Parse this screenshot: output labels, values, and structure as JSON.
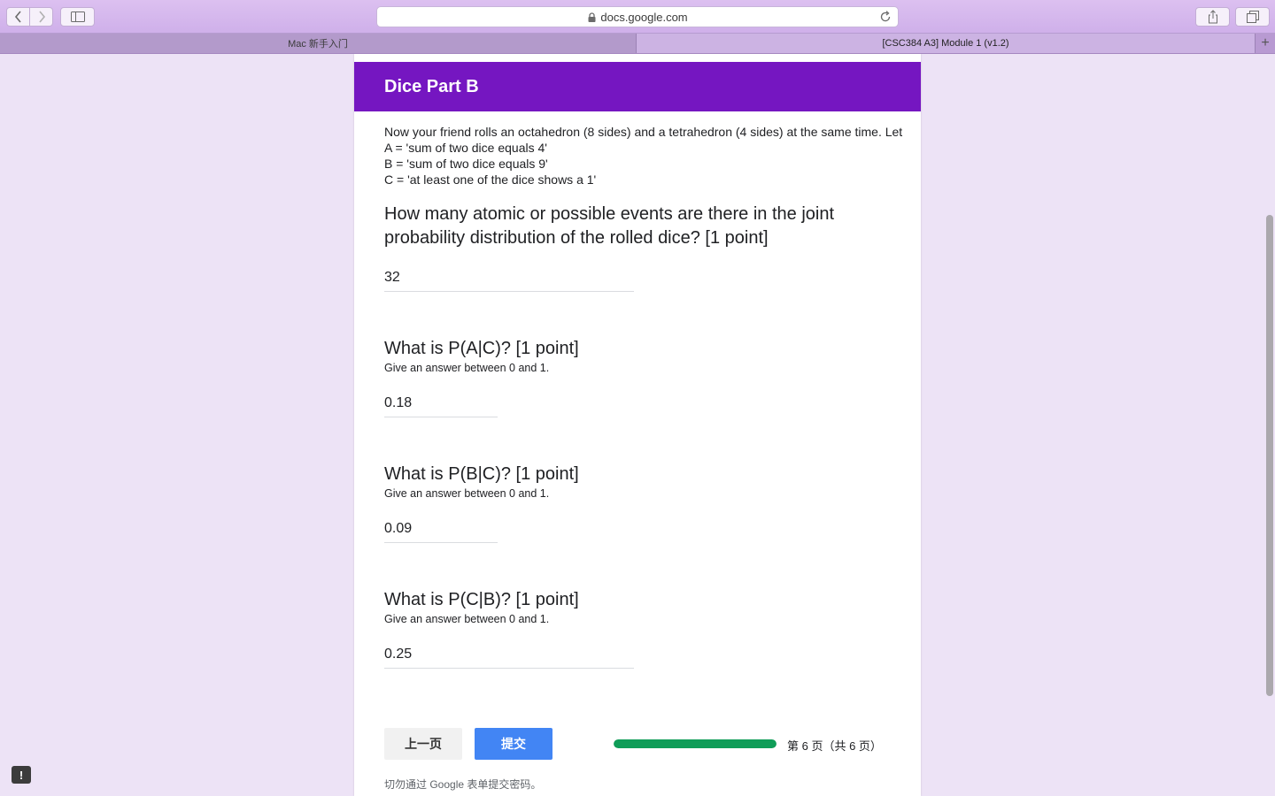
{
  "browser": {
    "url": "docs.google.com",
    "tabs": [
      {
        "label": "Mac 新手入门",
        "active": false
      },
      {
        "label": "[CSC384 A3] Module 1 (v1.2)",
        "active": true
      }
    ],
    "new_tab_symbol": "+"
  },
  "form": {
    "section_title": "Dice Part B",
    "intro_lines": [
      "Now your friend rolls an octahedron (8 sides) and a tetrahedron (4 sides) at the same time. Let",
      "A = 'sum of two dice equals 4'",
      "B = 'sum of two dice equals 9'",
      "C = 'at least one of the dice shows a 1'"
    ],
    "questions": [
      {
        "title": "How many atomic or possible events are there in the joint probability distribution of the rolled dice? [1 point]",
        "help": "",
        "answer": "32"
      },
      {
        "title": "What is P(A|C)? [1 point]",
        "help": "Give an answer between 0 and 1.",
        "answer": "0.18"
      },
      {
        "title": "What is P(B|C)? [1 point]",
        "help": "Give an answer between 0 and 1.",
        "answer": "0.09"
      },
      {
        "title": "What is P(C|B)? [1 point]",
        "help": "Give an answer between 0 and 1.",
        "answer": "0.25"
      }
    ],
    "prev_button": "上一页",
    "submit_button": "提交",
    "progress": {
      "fraction": 1.0,
      "label": "第 6 页（共 6 页）"
    },
    "footer_note": "切勿通过 Google 表单提交密码。"
  },
  "colors": {
    "header_bg": "#7516c1",
    "page_bg": "#ede3f6",
    "submit_bg": "#4285f4",
    "progress_fill": "#0f9d58"
  },
  "icons": [
    "back-icon",
    "forward-icon",
    "sidebar-icon",
    "lock-icon",
    "reload-icon",
    "share-icon",
    "tabs-icon",
    "feedback-icon"
  ]
}
